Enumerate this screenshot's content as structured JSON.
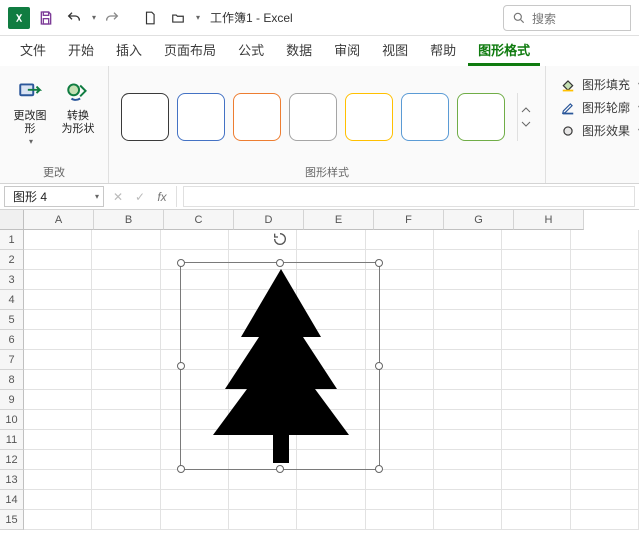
{
  "titlebar": {
    "doc_title": "工作簿1 - Excel",
    "search_placeholder": "搜索"
  },
  "tabs": {
    "items": [
      {
        "label": "文件"
      },
      {
        "label": "开始"
      },
      {
        "label": "插入"
      },
      {
        "label": "页面布局"
      },
      {
        "label": "公式"
      },
      {
        "label": "数据"
      },
      {
        "label": "审阅"
      },
      {
        "label": "视图"
      },
      {
        "label": "帮助"
      },
      {
        "label": "图形格式",
        "active": true
      }
    ]
  },
  "ribbon": {
    "change_group": {
      "label": "更改",
      "change_shape": "更改图\n形",
      "convert_shape": "转换\n为形状"
    },
    "styles_group": {
      "label": "图形样式",
      "swatch_borders": [
        "#3a3a3a",
        "#4472c4",
        "#ed7d31",
        "#a5a5a5",
        "#ffc000",
        "#5b9bd5",
        "#70ad47"
      ]
    },
    "format_group": {
      "fill": "图形填充",
      "outline": "图形轮廓",
      "effects": "图形效果"
    }
  },
  "formula_bar": {
    "namebox": "图形 4",
    "fx_label": "fx",
    "value": ""
  },
  "grid": {
    "columns": [
      "A",
      "B",
      "C",
      "D",
      "E",
      "F",
      "G",
      "H"
    ],
    "rows": [
      "1",
      "2",
      "3",
      "4",
      "5",
      "6",
      "7",
      "8",
      "9",
      "10",
      "11",
      "12",
      "13",
      "14",
      "15"
    ],
    "selected_shape_name": "图形 4"
  }
}
